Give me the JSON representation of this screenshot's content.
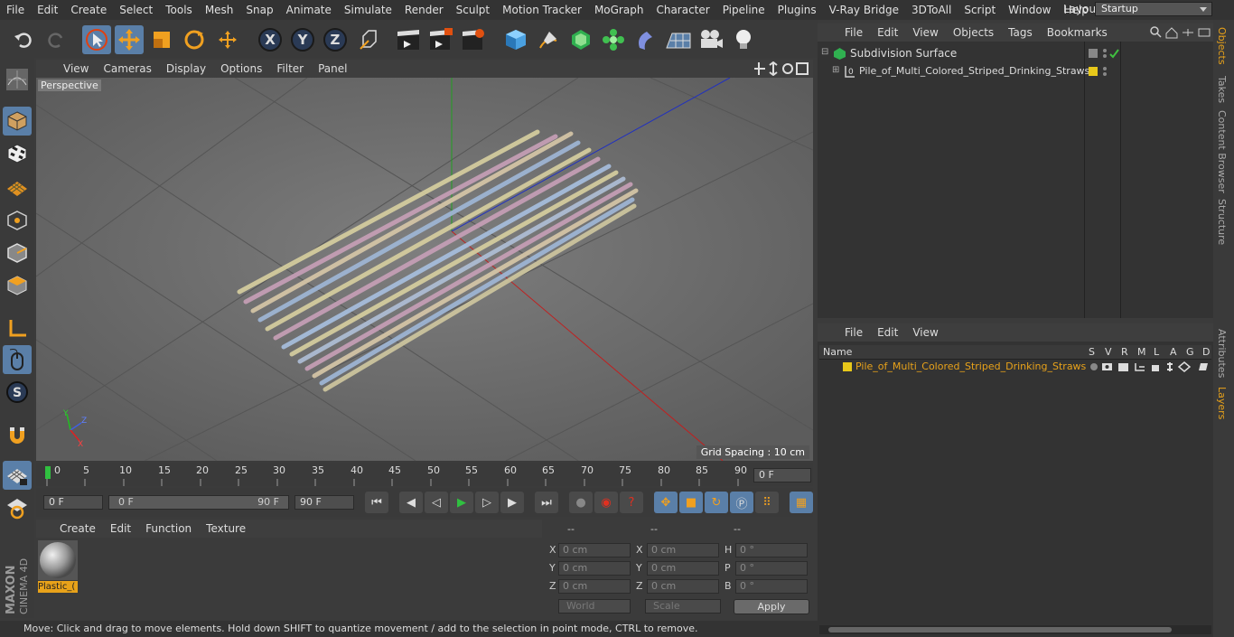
{
  "menu": [
    "File",
    "Edit",
    "Create",
    "Select",
    "Tools",
    "Mesh",
    "Snap",
    "Animate",
    "Simulate",
    "Render",
    "Sculpt",
    "Motion Tracker",
    "MoGraph",
    "Character",
    "Pipeline",
    "Plugins",
    "V-Ray Bridge",
    "3DToAll",
    "Script",
    "Window",
    "Help"
  ],
  "layout": {
    "label": "Layout:",
    "value": "Startup"
  },
  "toolbar": {
    "x": "X",
    "y": "Y",
    "z": "Z"
  },
  "viewport": {
    "menu": [
      "View",
      "Cameras",
      "Display",
      "Options",
      "Filter",
      "Panel"
    ],
    "label": "Perspective",
    "grid": "Grid Spacing : 10 cm"
  },
  "timeline": {
    "ticks": [
      "0",
      "5",
      "10",
      "15",
      "20",
      "25",
      "30",
      "35",
      "40",
      "45",
      "50",
      "55",
      "60",
      "65",
      "70",
      "75",
      "80",
      "85",
      "90"
    ],
    "current": "0 F",
    "start": "0 F",
    "range_start": "0 F",
    "range_end": "90 F",
    "end": "90 F"
  },
  "material": {
    "menu": [
      "Create",
      "Edit",
      "Function",
      "Texture"
    ],
    "name": "Plastic_(",
    "selected_color": "#e8a21a"
  },
  "coords": {
    "header": [
      "--",
      "--",
      "--"
    ],
    "pos_labels": [
      "X",
      "Y",
      "Z"
    ],
    "size_labels": [
      "X",
      "Y",
      "Z"
    ],
    "rot_labels": [
      "H",
      "P",
      "B"
    ],
    "pos": [
      "0 cm",
      "0 cm",
      "0 cm"
    ],
    "size": [
      "0 cm",
      "0 cm",
      "0 cm"
    ],
    "rot": [
      "0 °",
      "0 °",
      "0 °"
    ],
    "mode": "World",
    "scale": "Scale",
    "apply": "Apply"
  },
  "status": "Move: Click and drag to move elements. Hold down SHIFT to quantize movement / add to the selection in point mode, CTRL to remove.",
  "objects": {
    "menu": [
      "File",
      "Edit",
      "View",
      "Objects",
      "Tags",
      "Bookmarks"
    ],
    "items": [
      "Subdivision Surface",
      "Pile_of_Multi_Colored_Striped_Drinking_Straws"
    ]
  },
  "layers": {
    "menu": [
      "File",
      "Edit",
      "View"
    ],
    "name_col": "Name",
    "cols": [
      "S",
      "V",
      "R",
      "M",
      "L",
      "A",
      "G",
      "D"
    ],
    "item": "Pile_of_Multi_Colored_Striped_Drinking_Straws",
    "item_color": "#e8c81a"
  },
  "right_tabs": [
    "Objects",
    "Takes",
    "Content Browser",
    "Structure",
    "Attributes",
    "Layers"
  ],
  "brand": {
    "logo": "MAXON CINEMA 4D"
  }
}
